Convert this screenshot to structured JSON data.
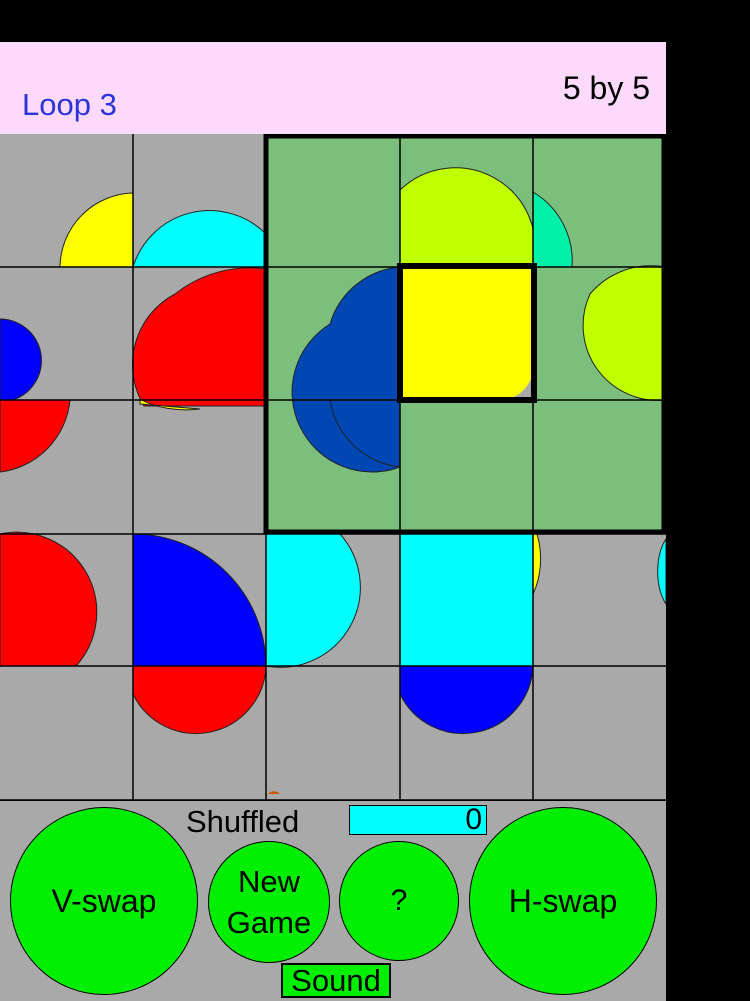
{
  "header": {
    "loop_label": "Loop 3",
    "size_label": "5 by 5"
  },
  "board": {
    "rows": 5,
    "cols": 5,
    "tile_background": "#a9a9a9",
    "highlight_color": "#7cbf7c",
    "highlight_region": {
      "row_start": 0,
      "row_end": 2,
      "col_start": 2,
      "col_end": 4
    },
    "selected_tile": {
      "row": 1,
      "col": 3
    }
  },
  "controls": {
    "v_swap_label": "V-swap",
    "new_game_label": "New\nGame",
    "help_label": "?",
    "h_swap_label": "H-swap",
    "shuffled_label": "Shuffled",
    "shuffled_count": "0",
    "sound_label": "Sound"
  },
  "colors": {
    "button_green": "#00ee00",
    "counter_cyan": "#00ffff",
    "header_pink": "#fdd9fb",
    "loop_text_blue": "#2b34d8"
  }
}
